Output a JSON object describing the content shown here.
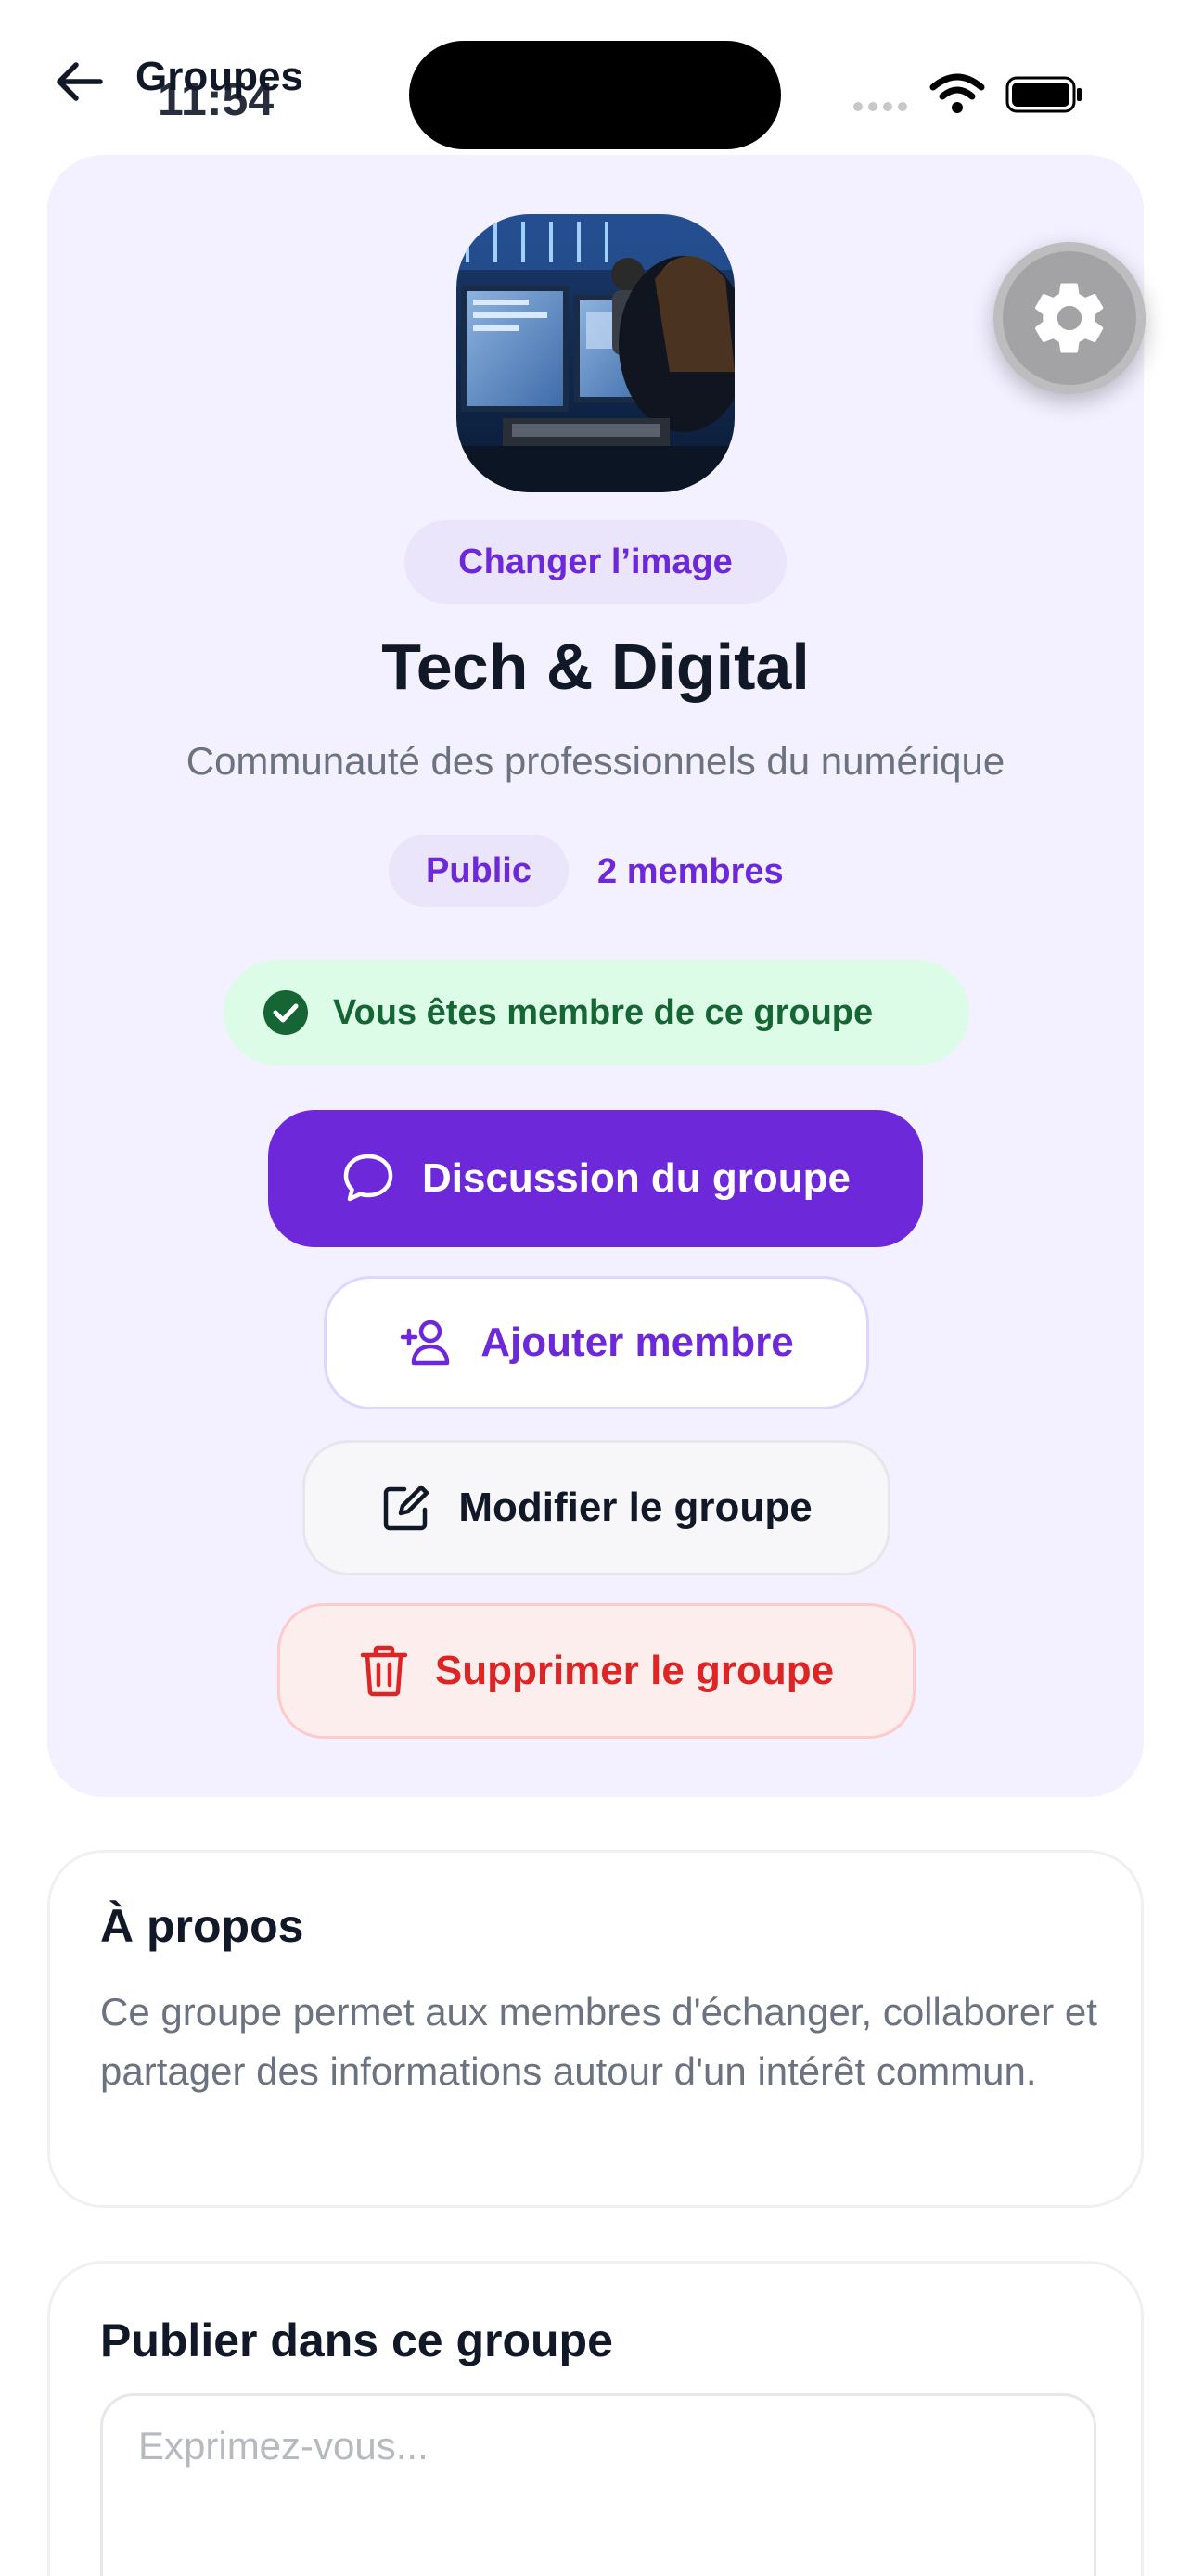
{
  "status_bar": {
    "time": "11:54"
  },
  "nav": {
    "back_title": "Groupes"
  },
  "group": {
    "change_image_label": "Changer l’image",
    "name": "Tech & Digital",
    "description": "Communauté des professionnels du numérique",
    "visibility": "Public",
    "members_count": "2 membres",
    "membership_status": "Vous êtes membre de ce groupe"
  },
  "actions": {
    "discussion": "Discussion du groupe",
    "add_member": "Ajouter membre",
    "edit": "Modifier le groupe",
    "delete": "Supprimer le groupe"
  },
  "about": {
    "title": "À propos",
    "text": "Ce groupe permet aux membres d'échanger, collaborer et partager des informations autour d'un intérêt commun."
  },
  "publish": {
    "title": "Publier dans ce groupe",
    "placeholder": "Exprimez-vous..."
  },
  "colors": {
    "accent": "#6d28d9",
    "hero_bg": "#f3f0ff",
    "success_bg": "#dcfce7",
    "success_text": "#166534",
    "danger": "#dc2626"
  },
  "icons": {
    "back": "arrow-left-icon",
    "settings": "gear-icon",
    "check": "check-circle-icon",
    "chat": "chat-bubble-icon",
    "add_user": "user-plus-icon",
    "edit": "edit-icon",
    "delete": "trash-icon"
  }
}
